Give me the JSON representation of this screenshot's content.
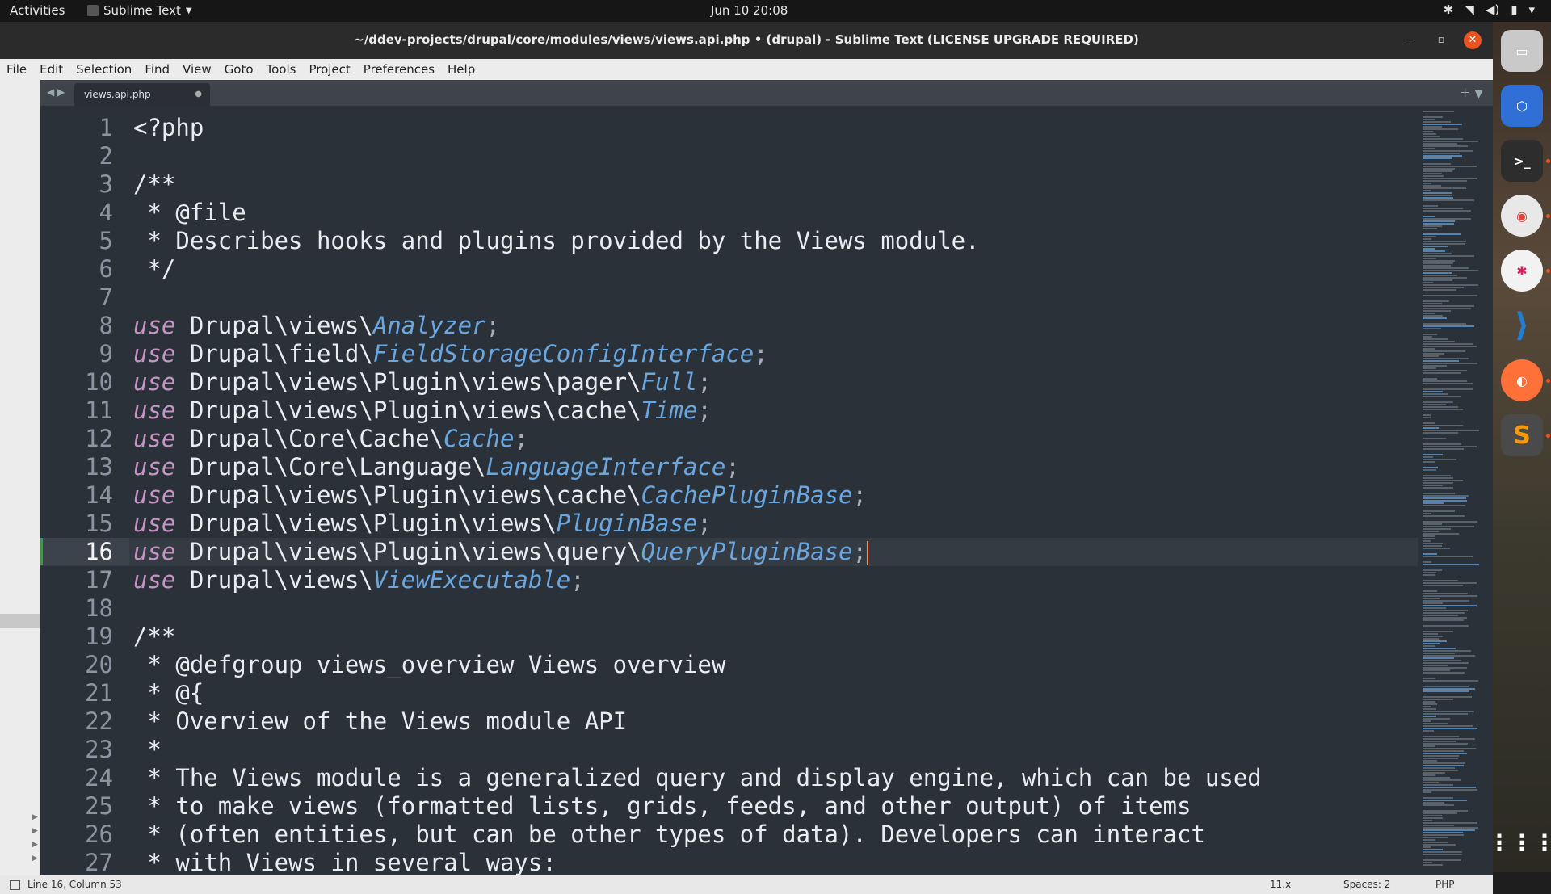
{
  "topbar": {
    "activities": "Activities",
    "app_name": "Sublime Text",
    "clock": "Jun 10  20:08"
  },
  "window": {
    "title": "~/ddev-projects/drupal/core/modules/views/views.api.php • (drupal) - Sublime Text (LICENSE UPGRADE REQUIRED)",
    "minimize": "–",
    "maximize": "▫",
    "close": "✕"
  },
  "menu": [
    "File",
    "Edit",
    "Selection",
    "Find",
    "View",
    "Goto",
    "Tools",
    "Project",
    "Preferences",
    "Help"
  ],
  "tabs": [
    {
      "label": "views.api.php",
      "modified": "●"
    }
  ],
  "editor": {
    "active_line": 16,
    "lines": [
      {
        "n": "1"
      },
      {
        "n": "2"
      },
      {
        "n": "3"
      },
      {
        "n": "4"
      },
      {
        "n": "5"
      },
      {
        "n": "6"
      },
      {
        "n": "7"
      },
      {
        "n": "8"
      },
      {
        "n": "9"
      },
      {
        "n": "10"
      },
      {
        "n": "11"
      },
      {
        "n": "12"
      },
      {
        "n": "13"
      },
      {
        "n": "14"
      },
      {
        "n": "15"
      },
      {
        "n": "16"
      },
      {
        "n": "17"
      },
      {
        "n": "18"
      },
      {
        "n": "19"
      },
      {
        "n": "20"
      },
      {
        "n": "21"
      },
      {
        "n": "22"
      },
      {
        "n": "23"
      },
      {
        "n": "24"
      },
      {
        "n": "25"
      },
      {
        "n": "26"
      },
      {
        "n": "27"
      }
    ],
    "code": {
      "l1": "<?php",
      "l3": "/**",
      "l4": " * @file",
      "l5": " * Describes hooks and plugins provided by the Views module.",
      "l6": " */",
      "use": "use",
      "l8_ns": " Drupal\\views\\",
      "l8_cls": "Analyzer",
      "l9_ns": " Drupal\\field\\",
      "l9_cls": "FieldStorageConfigInterface",
      "l10_ns": " Drupal\\views\\Plugin\\views\\pager\\",
      "l10_cls": "Full",
      "l11_ns": " Drupal\\views\\Plugin\\views\\cache\\",
      "l11_cls": "Time",
      "l12_ns": " Drupal\\Core\\Cache\\",
      "l12_cls": "Cache",
      "l13_ns": " Drupal\\Core\\Language\\",
      "l13_cls": "LanguageInterface",
      "l14_ns": " Drupal\\views\\Plugin\\views\\cache\\",
      "l14_cls": "CachePluginBase",
      "l15_ns": " Drupal\\views\\Plugin\\views\\",
      "l15_cls": "PluginBase",
      "l16_ns": " Drupal\\views\\Plugin\\views\\query\\",
      "l16_cls": "QueryPluginBase",
      "l17_ns": " Drupal\\views\\",
      "l17_cls": "ViewExecutable",
      "semi": ";",
      "l19": "/**",
      "l20": " * @defgroup views_overview Views overview",
      "l21": " * @{",
      "l22": " * Overview of the Views module API",
      "l23": " *",
      "l24": " * The Views module is a generalized query and display engine, which can be used",
      "l25": " * to make views (formatted lists, grids, feeds, and other output) of items",
      "l26": " * (often entities, but can be other types of data). Developers can interact",
      "l27": " * with Views in several ways:"
    }
  },
  "status": {
    "position": "Line 16, Column 53",
    "version": "11.x",
    "spaces": "Spaces: 2",
    "syntax": "PHP"
  },
  "dock": [
    {
      "name": "files-icon",
      "color": "#c9c9c9"
    },
    {
      "name": "virtualbox-icon",
      "color": "#2f6fd6"
    },
    {
      "name": "terminal-icon",
      "color": "#2d2d2d"
    },
    {
      "name": "chrome-icon",
      "color": "#e8e8e8"
    },
    {
      "name": "slack-icon",
      "color": "#f2f2f2"
    },
    {
      "name": "vscode-icon",
      "color": "#1f7fd6"
    },
    {
      "name": "firefox-icon",
      "color": "#ff7139"
    },
    {
      "name": "sublime-icon",
      "color": "#4a4a4a"
    },
    {
      "name": "app-grid-icon",
      "color": "transparent"
    }
  ]
}
